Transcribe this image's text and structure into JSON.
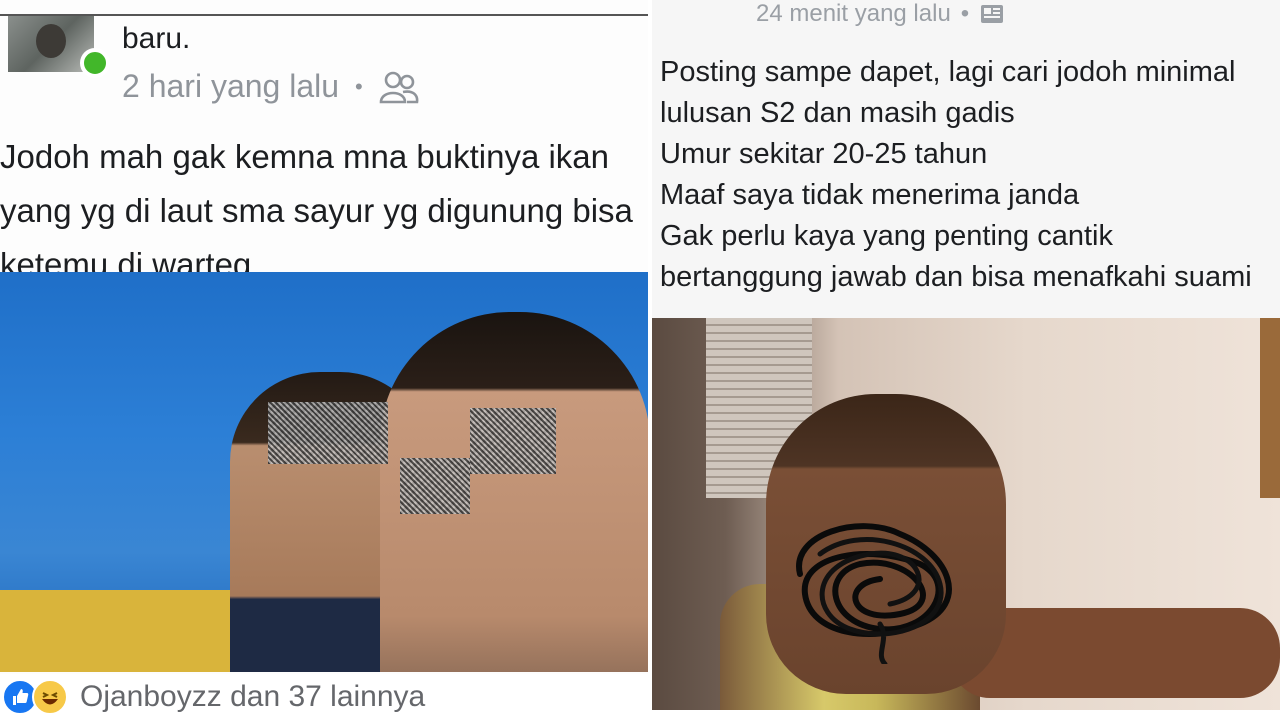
{
  "left_post": {
    "author": "baru.",
    "timestamp": "2 hari yang lalu",
    "separator": "•",
    "audience_icon": "friends-icon",
    "text_lines": [
      "Jodoh mah gak kemna mna buktinya ikan",
      "yang yg di laut sma sayur yg digunung bisa",
      "ketemu di warteg"
    ],
    "reactions": {
      "icons": [
        "like-icon",
        "haha-icon"
      ],
      "summary": "Ojanboyzz dan 37 lainnya"
    }
  },
  "right_post": {
    "timestamp": "24 menit yang lalu",
    "separator": "•",
    "audience_icon": "globe-icon",
    "text_lines": [
      "Posting sampe dapet,  lagi cari jodoh minimal",
      "lulusan S2 dan masih gadis",
      "Umur sekitar 20-25 tahun",
      "Maaf saya tidak menerima janda",
      "Gak perlu kaya yang penting cantik",
      "bertanggung jawab dan bisa menafkahi suami"
    ]
  },
  "colors": {
    "online": "#42b72a",
    "like": "#1877f2",
    "haha": "#f7c948",
    "meta_text": "#8f949a"
  }
}
